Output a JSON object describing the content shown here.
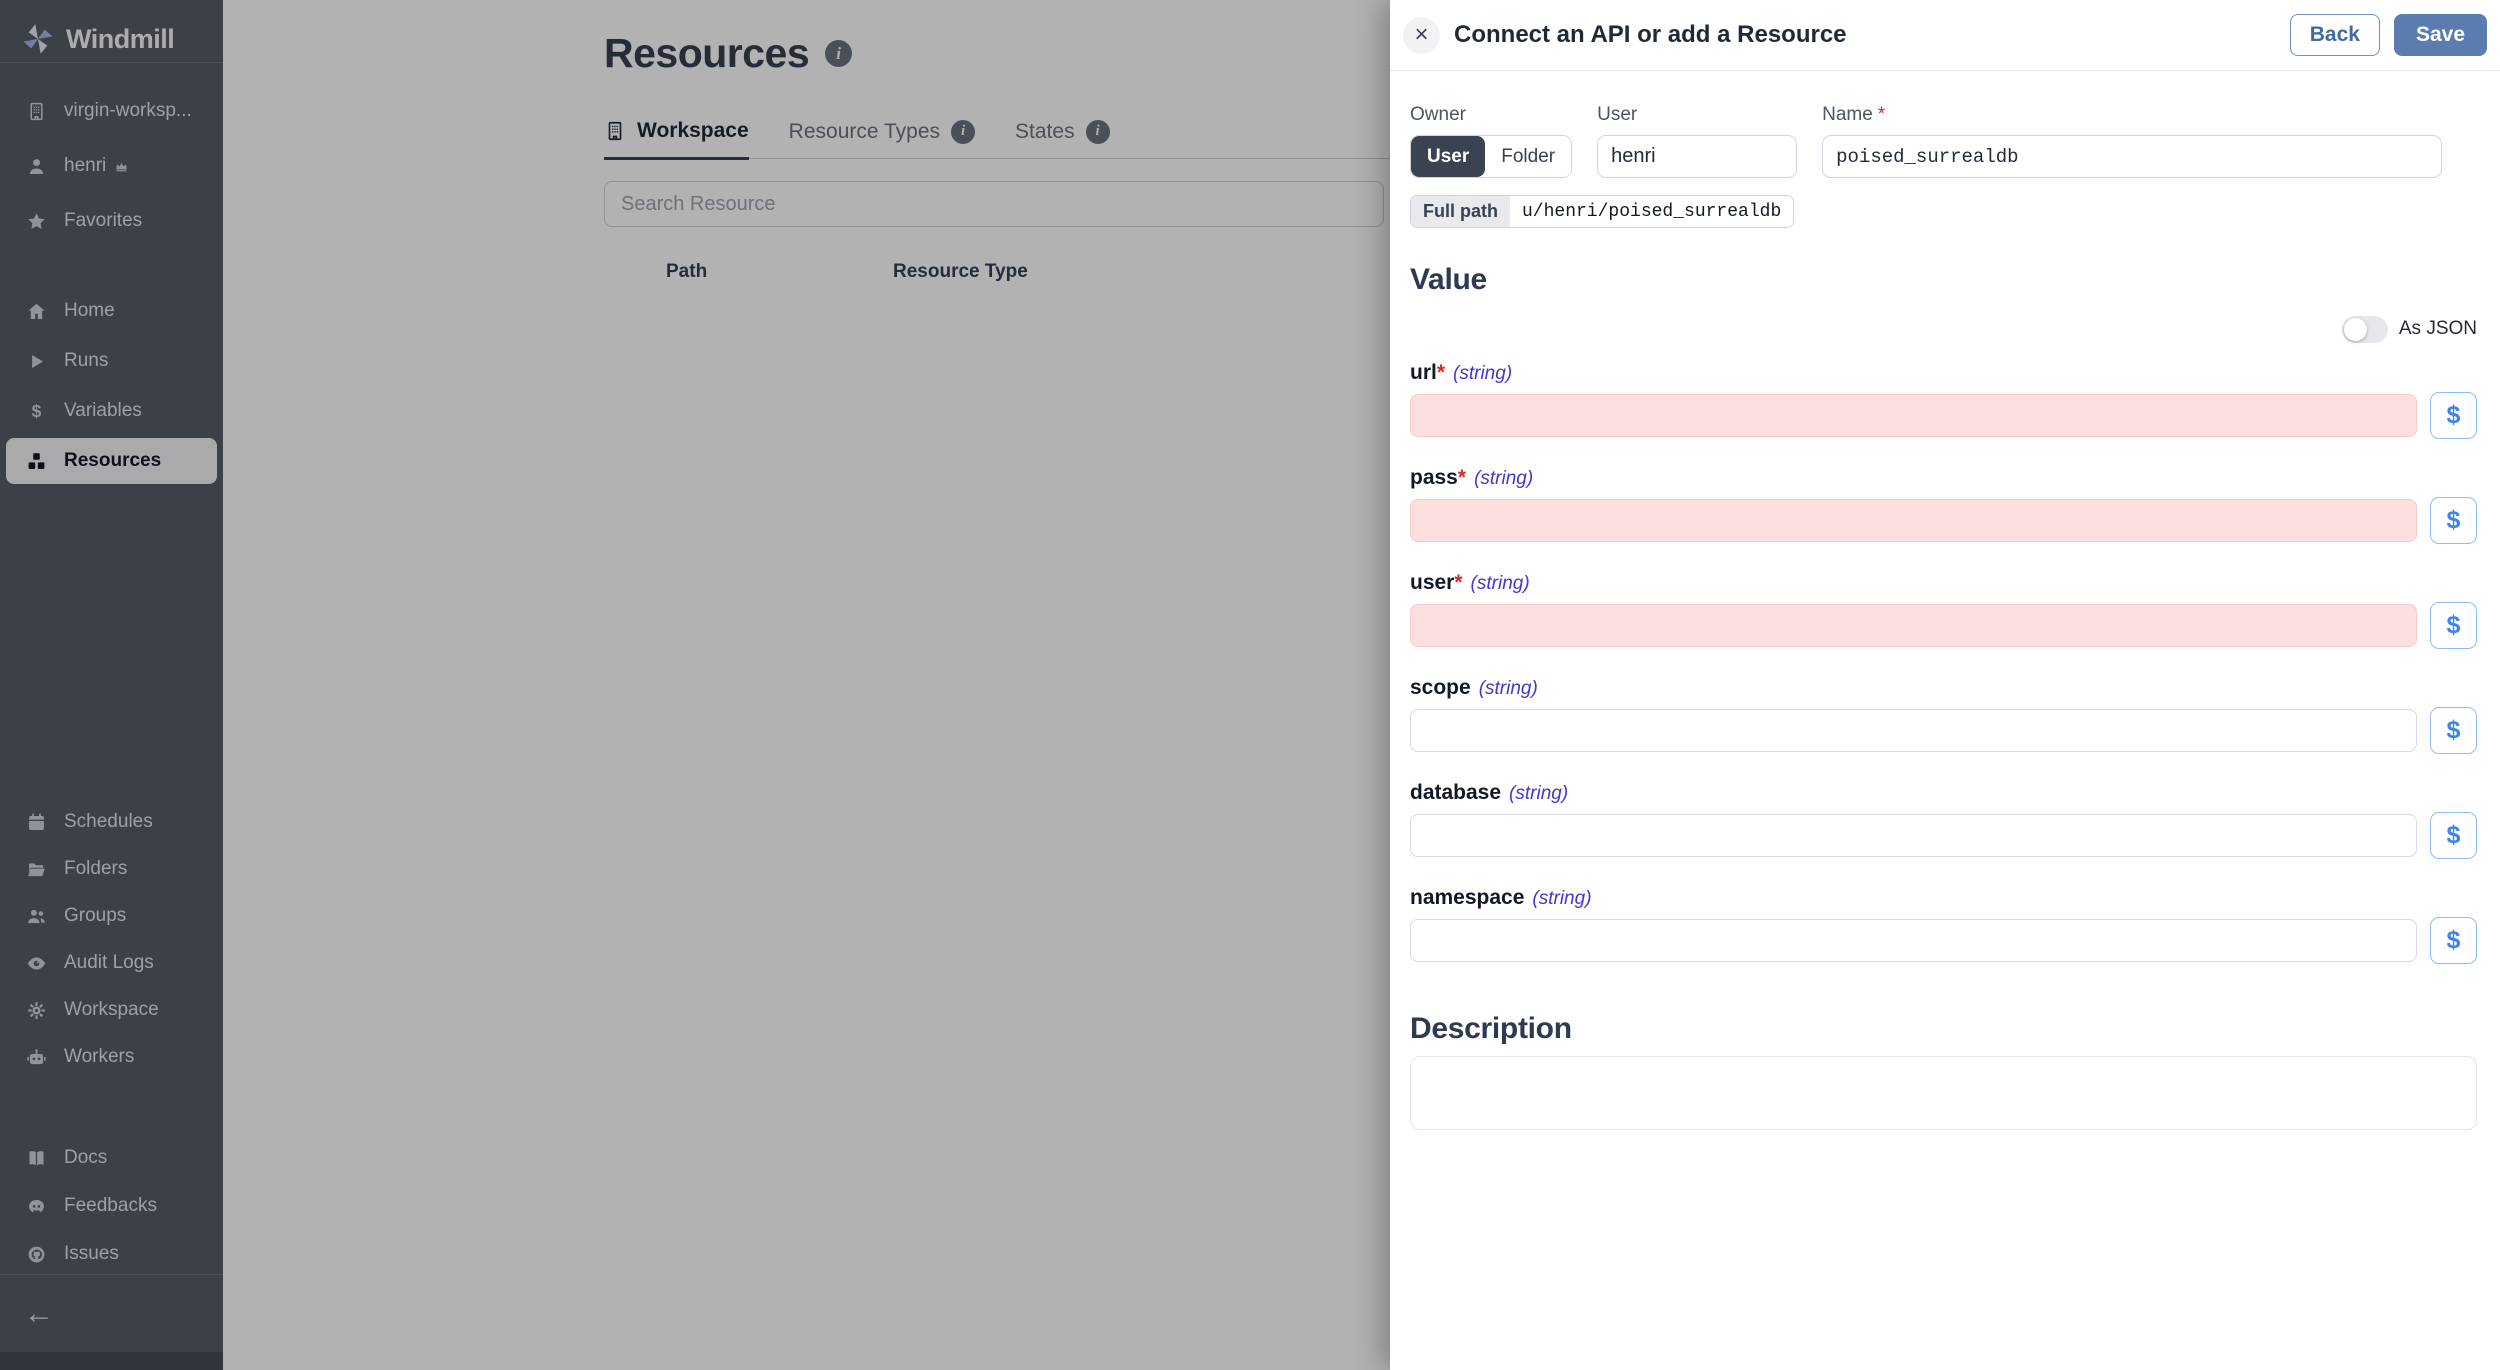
{
  "sidebar": {
    "logo": "Windmill",
    "groups": {
      "top": [
        {
          "icon": "building",
          "label": "virgin-worksp...",
          "name": "workspace-switcher"
        },
        {
          "icon": "user",
          "label": "henri",
          "crown": true,
          "name": "user-menu"
        },
        {
          "icon": "star",
          "label": "Favorites",
          "name": "favorites"
        }
      ],
      "nav": [
        {
          "icon": "home",
          "label": "Home",
          "name": "home"
        },
        {
          "icon": "play",
          "label": "Runs",
          "name": "runs"
        },
        {
          "icon": "dollar",
          "label": "Variables",
          "name": "variables"
        },
        {
          "icon": "boxes",
          "label": "Resources",
          "name": "resources",
          "active": true
        }
      ],
      "admin": [
        {
          "icon": "calendar",
          "label": "Schedules",
          "name": "schedules"
        },
        {
          "icon": "folder",
          "label": "Folders",
          "name": "folders"
        },
        {
          "icon": "users",
          "label": "Groups",
          "name": "groups"
        },
        {
          "icon": "eye",
          "label": "Audit Logs",
          "name": "audit-logs"
        },
        {
          "icon": "gear",
          "label": "Workspace",
          "name": "workspace"
        },
        {
          "icon": "bot",
          "label": "Workers",
          "name": "workers"
        }
      ],
      "footer": [
        {
          "icon": "book",
          "label": "Docs",
          "name": "docs"
        },
        {
          "icon": "discord",
          "label": "Feedbacks",
          "name": "feedbacks"
        },
        {
          "icon": "github",
          "label": "Issues",
          "name": "issues"
        }
      ]
    },
    "collapse_arrow": "←"
  },
  "main": {
    "title": "Resources",
    "tabs": [
      {
        "label": "Workspace",
        "icon": "building",
        "active": true
      },
      {
        "label": "Resource Types",
        "info": true
      },
      {
        "label": "States",
        "info": true
      }
    ],
    "search_placeholder": "Search Resource",
    "table_headers": [
      "Path",
      "Resource Type"
    ]
  },
  "drawer": {
    "title": "Connect an API or add a Resource",
    "close_glyph": "×",
    "back_label": "Back",
    "save_label": "Save",
    "owner_label": "Owner",
    "owner_options": [
      "User",
      "Folder"
    ],
    "owner_selected": "User",
    "user_label": "User",
    "user_value": "henri",
    "name_label": "Name",
    "required_mark": "*",
    "name_value": "poised_surrealdb",
    "full_path_label": "Full path",
    "full_path_value": "u/henri/poised_surrealdb",
    "value_heading": "Value",
    "as_json_label": "As JSON",
    "as_json_on": false,
    "dollar_glyph": "$",
    "fields": [
      {
        "name": "url",
        "type": "(string)",
        "required": true,
        "value": ""
      },
      {
        "name": "pass",
        "type": "(string)",
        "required": true,
        "value": ""
      },
      {
        "name": "user",
        "type": "(string)",
        "required": true,
        "value": ""
      },
      {
        "name": "scope",
        "type": "(string)",
        "required": false,
        "value": ""
      },
      {
        "name": "database",
        "type": "(string)",
        "required": false,
        "value": ""
      },
      {
        "name": "namespace",
        "type": "(string)",
        "required": false,
        "value": ""
      }
    ],
    "description_heading": "Description",
    "description_value": ""
  },
  "icons": {
    "info_glyph": "i"
  },
  "colors": {
    "frost_blue": "#5a7cae",
    "dollar_blue": "#3b82f6",
    "required_bg": "#fcdfde",
    "required_border": "#f6caca",
    "sidebar_bg": "#565c66"
  }
}
